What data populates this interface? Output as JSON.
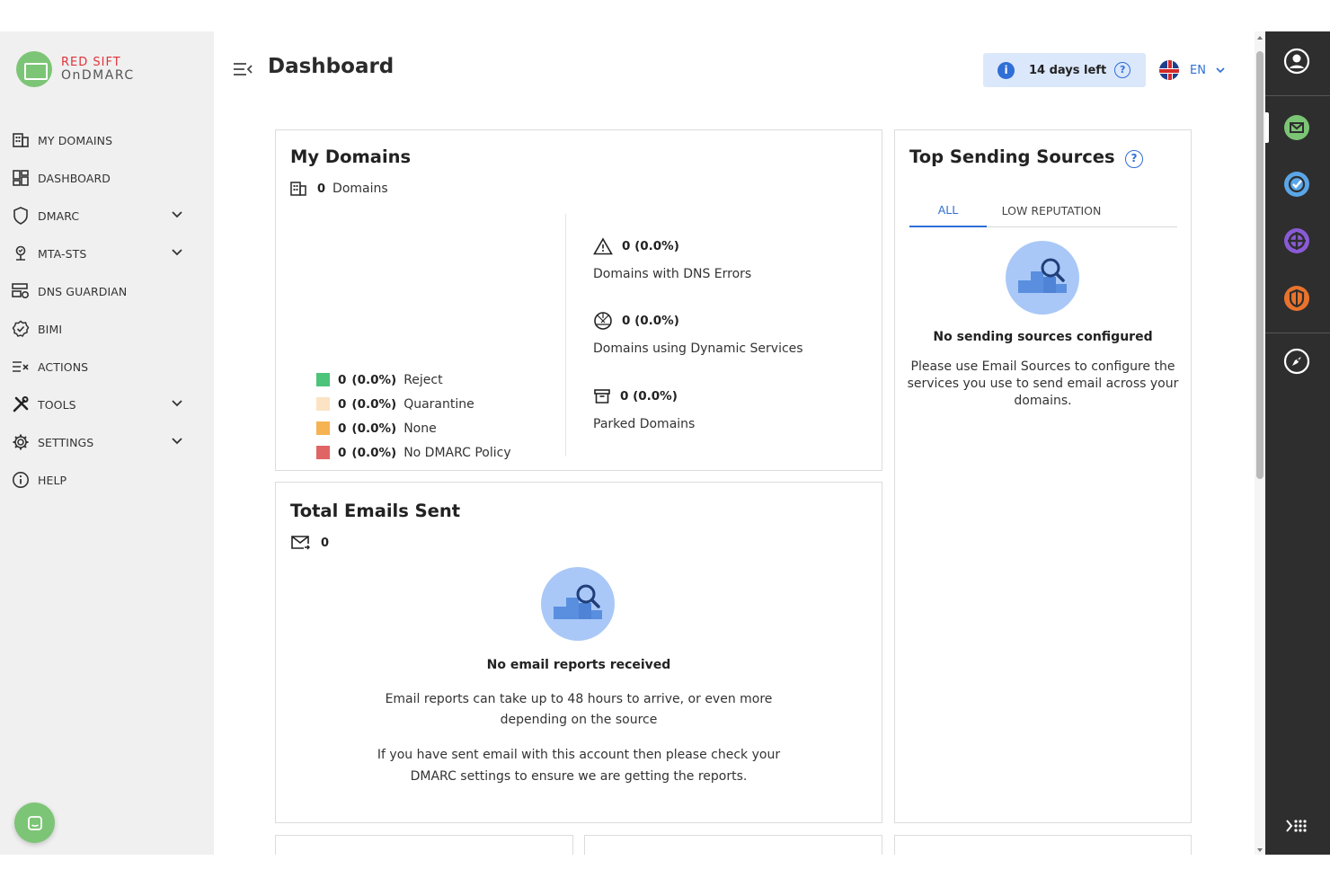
{
  "brand": {
    "line1": "RED SIFT",
    "line2": "OnDMARC"
  },
  "header": {
    "title": "Dashboard",
    "trial_text": "14 days left",
    "language": "EN"
  },
  "sidebar": {
    "items": [
      {
        "label": "MY DOMAINS",
        "icon": "building-icon",
        "has_submenu": false
      },
      {
        "label": "DASHBOARD",
        "icon": "dashboard-icon",
        "has_submenu": false
      },
      {
        "label": "DMARC",
        "icon": "shield-icon",
        "has_submenu": true
      },
      {
        "label": "MTA-STS",
        "icon": "mta-sts-icon",
        "has_submenu": true
      },
      {
        "label": "DNS GUARDIAN",
        "icon": "dns-guardian-icon",
        "has_submenu": false
      },
      {
        "label": "BIMI",
        "icon": "badge-check-icon",
        "has_submenu": false
      },
      {
        "label": "ACTIONS",
        "icon": "actions-list-icon",
        "has_submenu": false
      },
      {
        "label": "TOOLS",
        "icon": "tools-icon",
        "has_submenu": true
      },
      {
        "label": "SETTINGS",
        "icon": "gear-icon",
        "has_submenu": true
      },
      {
        "label": "HELP",
        "icon": "info-icon",
        "has_submenu": false
      }
    ]
  },
  "my_domains": {
    "title": "My Domains",
    "count": "0",
    "count_label": "Domains",
    "legend": [
      {
        "value": "0",
        "pct": "(0.0%)",
        "label": "Reject",
        "color": "#4cc479"
      },
      {
        "value": "0",
        "pct": "(0.0%)",
        "label": "Quarantine",
        "color": "#fbe3c4"
      },
      {
        "value": "0",
        "pct": "(0.0%)",
        "label": "None",
        "color": "#f6b352"
      },
      {
        "value": "0",
        "pct": "(0.0%)",
        "label": "No DMARC Policy",
        "color": "#e06464"
      }
    ],
    "stats": [
      {
        "value": "0 (0.0%)",
        "label": "Domains with DNS Errors",
        "icon": "warning-triangle-icon"
      },
      {
        "value": "0 (0.0%)",
        "label": "Domains using Dynamic Services",
        "icon": "dynamic-services-icon"
      },
      {
        "value": "0 (0.0%)",
        "label": "Parked Domains",
        "icon": "archive-icon"
      }
    ]
  },
  "total_emails": {
    "title": "Total Emails Sent",
    "count": "0",
    "empty_title": "No email reports received",
    "empty_text_1": "Email reports can take up to 48 hours to arrive, or even more depending on the source",
    "empty_text_2": "If you have sent email with this account then please check your DMARC settings to ensure we are getting the reports."
  },
  "top_sources": {
    "title": "Top Sending Sources",
    "tabs": [
      "ALL",
      "LOW REPUTATION"
    ],
    "active_tab": "ALL",
    "empty_title": "No sending sources configured",
    "empty_text": "Please use Email Sources to configure the services you use to send email across your domains."
  },
  "colors": {
    "accent": "#2f6fd6",
    "brand_green": "#7cc576",
    "appbar": "#2e2e2e"
  }
}
